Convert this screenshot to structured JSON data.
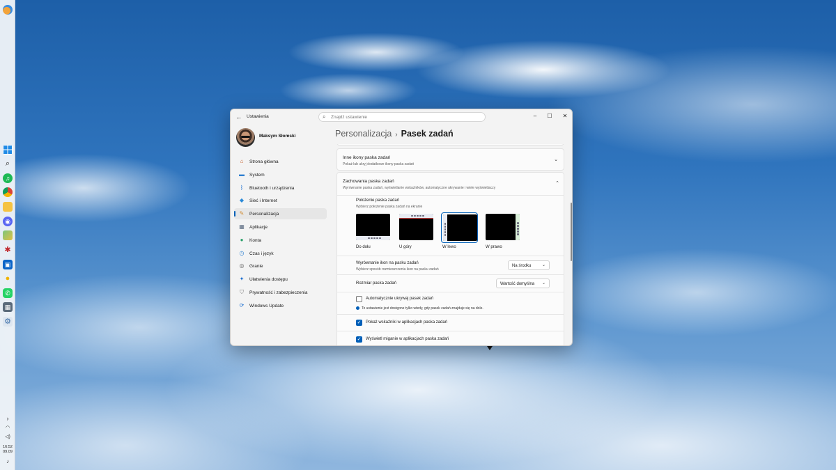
{
  "taskbar": {
    "clock_time": "16:52",
    "clock_date": "09.09"
  },
  "window": {
    "app_title": "Ustawienia",
    "search_placeholder": "Znajdź ustawienie",
    "back_glyph": "←",
    "minimize_glyph": "–",
    "maximize_glyph": "☐",
    "close_glyph": "✕"
  },
  "sidebar": {
    "profile_name": "Maksym Słomski",
    "items": [
      {
        "label": "Strona główna",
        "icon": "home-icon"
      },
      {
        "label": "System",
        "icon": "monitor-icon"
      },
      {
        "label": "Bluetooth i urządzenia",
        "icon": "bluetooth-icon"
      },
      {
        "label": "Sieć i Internet",
        "icon": "wifi-icon"
      },
      {
        "label": "Personalizacja",
        "icon": "brush-icon"
      },
      {
        "label": "Aplikacje",
        "icon": "apps-icon"
      },
      {
        "label": "Konta",
        "icon": "person-icon"
      },
      {
        "label": "Czas i język",
        "icon": "globe-clock-icon"
      },
      {
        "label": "Granie",
        "icon": "gamepad-icon"
      },
      {
        "label": "Ułatwienia dostępu",
        "icon": "accessibility-icon"
      },
      {
        "label": "Prywatność i zabezpieczenia",
        "icon": "shield-icon"
      },
      {
        "label": "Windows Update",
        "icon": "update-icon"
      }
    ],
    "active_index": 4
  },
  "breadcrumb": {
    "parent": "Personalizacja",
    "separator": "›",
    "current": "Pasek zadań"
  },
  "main": {
    "other_icons": {
      "title": "Inne ikony paska zadań",
      "subtitle": "Pokaż lub ukryj dodatkowe ikony paska zadań"
    },
    "behaviors": {
      "title": "Zachowania paska zadań",
      "subtitle": "Wyrównanie paska zadań, wyświetlanie wskaźników, automatyczne ukrywanie i wiele wyświetlaczy"
    },
    "position": {
      "title": "Położenie paska zadań",
      "subtitle": "Wybierz położenie paska zadań na ekranie",
      "options": [
        {
          "label": "Do dołu"
        },
        {
          "label": "U góry"
        },
        {
          "label": "W lewo"
        },
        {
          "label": "W prawo"
        }
      ],
      "selected_index": 2
    },
    "alignment": {
      "title": "Wyrównanie ikon na pasku zadań",
      "subtitle": "Wybierz sposób rozmieszczenia ikon na pasku zadań",
      "value": "Na środku"
    },
    "size": {
      "title": "Rozmiar paska zadań",
      "value": "Wartość domyślna"
    },
    "autohide": {
      "label": "Automatycznie ukrywaj pasek zadań",
      "checked": false,
      "info": "To ustawienie jest dostępne tylko wtedy, gdy pasek zadań znajduje się na dole."
    },
    "indicators": {
      "label": "Pokaż wskaźniki w aplikacjach paska zadań",
      "checked": true
    },
    "flashing": {
      "label": "Wyświetl miganie w aplikacjach paska zadań",
      "checked": true
    }
  }
}
